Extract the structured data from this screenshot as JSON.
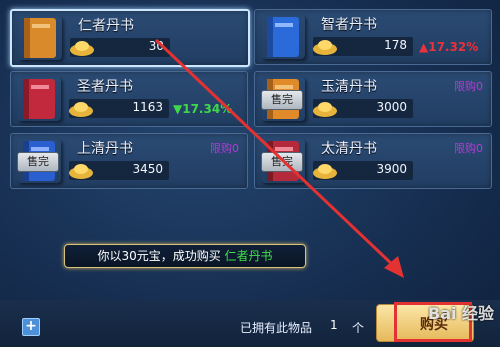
{
  "items": [
    {
      "name": "仁者丹书",
      "price": "30",
      "color": "#d98a2a",
      "selected": true,
      "sold_out": false,
      "trend": "",
      "trend_dir": "",
      "limit": ""
    },
    {
      "name": "智者丹书",
      "price": "178",
      "color": "#2a6ad9",
      "selected": false,
      "sold_out": false,
      "trend": "17.32%",
      "trend_dir": "up",
      "limit": ""
    },
    {
      "name": "圣者丹书",
      "price": "1163",
      "color": "#c2293c",
      "selected": false,
      "sold_out": false,
      "trend": "17.34%",
      "trend_dir": "down",
      "limit": ""
    },
    {
      "name": "玉清丹书",
      "price": "3000",
      "color": "#e08a2a",
      "selected": false,
      "sold_out": true,
      "trend": "",
      "trend_dir": "",
      "limit": "限购0"
    },
    {
      "name": "上清丹书",
      "price": "3450",
      "color": "#2a5fd0",
      "selected": false,
      "sold_out": true,
      "trend": "",
      "trend_dir": "",
      "limit": "限购0"
    },
    {
      "name": "太清丹书",
      "price": "3900",
      "color": "#b42a3a",
      "selected": false,
      "sold_out": true,
      "trend": "",
      "trend_dir": "",
      "limit": "限购0"
    }
  ],
  "sold_out_label": "售完",
  "toast": {
    "prefix": "你以30元宝，成功购买",
    "item": "仁者丹书"
  },
  "footer": {
    "owned_label": "已拥有此物品",
    "owned_count": "1",
    "unit": "个",
    "buy_label": "购买",
    "plus_label": "+"
  },
  "watermark": "Bai 经验"
}
